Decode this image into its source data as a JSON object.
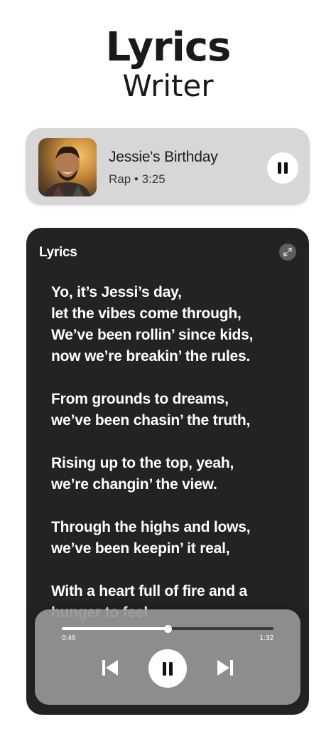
{
  "header": {
    "title": "Lyrics",
    "subtitle": "Writer"
  },
  "now_playing": {
    "title": "Jessie's Birthday",
    "meta": "Rap • 3:25",
    "cover_icon": "album-cover-photo",
    "pause_icon": "pause-icon"
  },
  "lyrics": {
    "label": "Lyrics",
    "expand_icon": "expand-icon",
    "stanzas": [
      [
        "Yo, it’s Jessi’s day,",
        "let the vibes come through,",
        "We’ve been rollin’ since kids,",
        "now we’re breakin’ the rules."
      ],
      [
        "From grounds to dreams,",
        "we’ve been chasin’ the truth,"
      ],
      [
        "Rising up to the top, yeah,",
        "we’re changin’ the view."
      ],
      [
        "Through the highs and lows,",
        "we’ve been keepin’ it real,"
      ],
      [
        "With a heart full of fire and a",
        "hunger to feel"
      ]
    ]
  },
  "player": {
    "elapsed": "0:46",
    "total": "1:32",
    "progress": 0.5,
    "prev_icon": "skip-previous-icon",
    "play_icon": "pause-icon",
    "next_icon": "skip-next-icon"
  },
  "colors": {
    "background": "#ffffff",
    "card": "#d7d7d7",
    "panel": "#232323",
    "player": "#969696",
    "accent": "#ffffff"
  }
}
